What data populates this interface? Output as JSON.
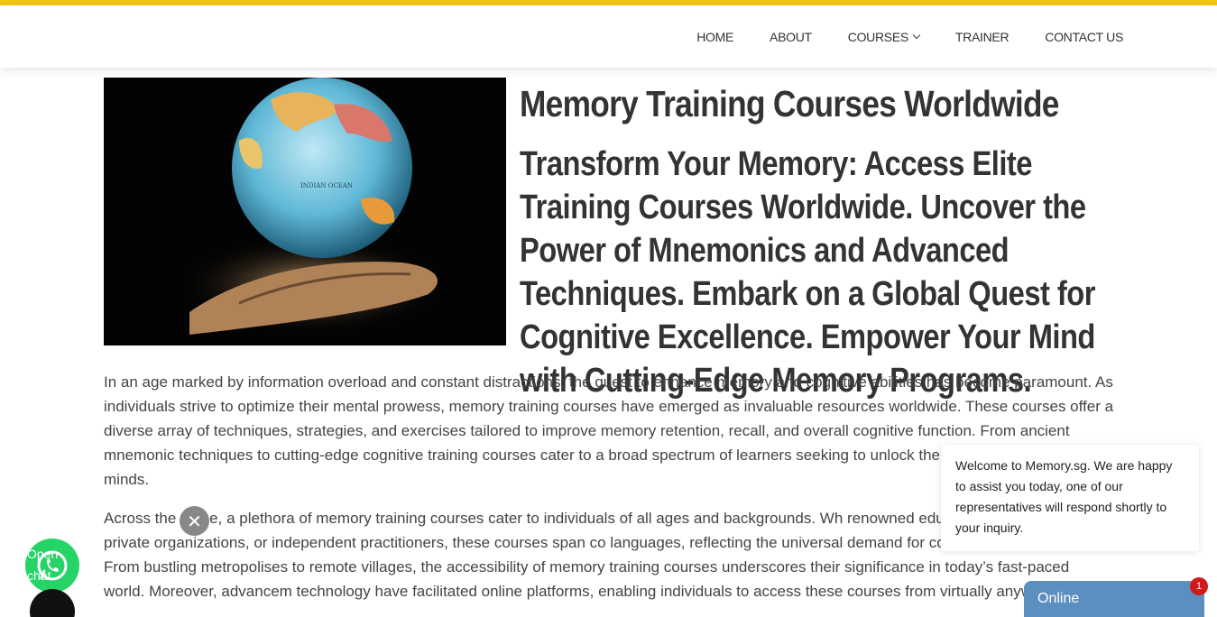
{
  "nav": {
    "items": [
      {
        "label": "HOME",
        "has_dropdown": false
      },
      {
        "label": "ABOUT",
        "has_dropdown": false
      },
      {
        "label": "COURSES",
        "has_dropdown": true
      },
      {
        "label": "TRAINER",
        "has_dropdown": false
      },
      {
        "label": "CONTACT US",
        "has_dropdown": false
      }
    ]
  },
  "hero": {
    "image_icon": "globe-in-hand-image",
    "ocean_label": "INDIAN OCEAN",
    "title": "Memory Training Courses Worldwide",
    "subtitle": "Transform Your Memory: Access Elite Training Courses Worldwide. Uncover the Power of Mnemonics and Advanced Techniques. Embark on a Global Quest for Cognitive Excellence. Empower Your Mind with Cutting-Edge Memory Programs."
  },
  "article": {
    "paragraph_1": "In an age marked by information overload and constant distractions, the quest to enhance memory and cognitive abilities has become paramount. As individuals strive to optimize their mental prowess, memory training courses have emerged as invaluable resources worldwide. These courses offer a diverse array of techniques, strategies, and exercises tailored to improve memory retention, recall, and overall cognitive function. From ancient mnemonic techniques to cutting-edge cognitive training courses cater to a broad spectrum of learners seeking to unlock the full potential of their minds.",
    "paragraph_2": "Across the globe, a plethora of memory training courses cater to individuals of all ages and backgrounds. Wh renowned educational institutions, private organizations, or independent practitioners, these courses span co languages, reflecting the universal demand for cognitive enhancement. From bustling metropolises to remote villages, the accessibility of memory training courses underscores their significance in today’s fast-paced world. Moreover, advancem technology have facilitated online platforms, enabling individuals to access these courses from virtually anywhere with a"
  },
  "chat": {
    "welcome_message": "Welcome to Memory.sg. We are happy to assist you today, one of our representatives will respond shortly to your inquiry.",
    "status_label": "Online",
    "unread_count": "1"
  },
  "whatsapp": {
    "label": "Open chat",
    "icon": "whatsapp-icon"
  },
  "close_glyph": "✕",
  "colors": {
    "accent_bar": "#f5c518",
    "chat_tab": "#5b8fc0",
    "whatsapp_green": "#25d366",
    "badge_red": "#d11a1a"
  }
}
